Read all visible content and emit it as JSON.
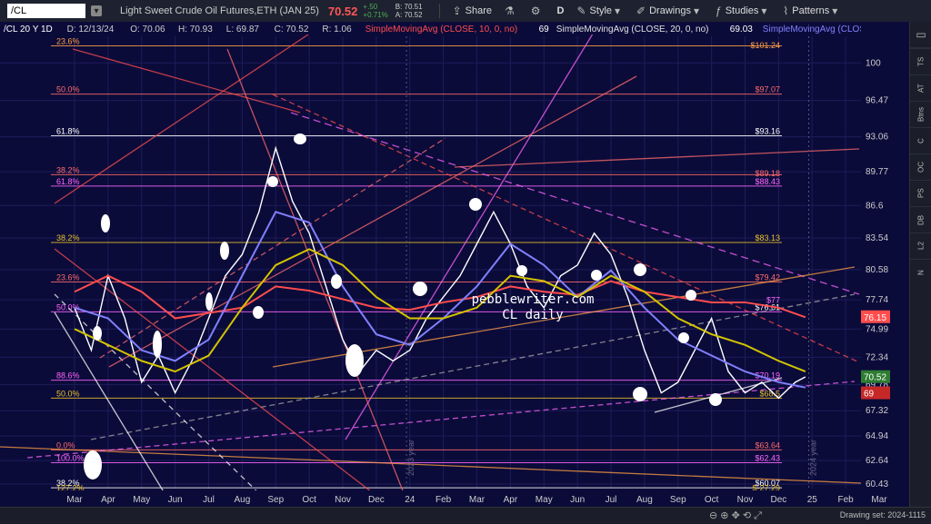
{
  "toolbar": {
    "symbol": "/CL",
    "description": "Light Sweet Crude Oil Futures,ETH (JAN 25)",
    "last": "70.52",
    "change": "+.50",
    "change_pct": "+0.71%",
    "bid": "B: 70.51",
    "ask": "A: 70.52",
    "share": "Share",
    "timeframe": "D",
    "style": "Style",
    "drawings": "Drawings",
    "studies": "Studies",
    "patterns": "Patterns"
  },
  "right_tabs": [
    "TS",
    "AT",
    "Btns",
    "C",
    "OC",
    "PS",
    "DB",
    "L2",
    "N"
  ],
  "bottom": {
    "drawing_set": "Drawing set: 2024-1115"
  },
  "chart_data": {
    "type": "line",
    "header": {
      "symbol": "/CL 20 Y 1D",
      "date": "D: 12/13/24",
      "open": "O: 70.06",
      "high": "H: 70.93",
      "low": "L: 69.87",
      "close": "C: 70.52",
      "range": "R: 1.06",
      "studies": [
        {
          "label": "SimpleMovingAvg (CLOSE, 10, 0, no)",
          "value": "69",
          "color": "#ff4d4d"
        },
        {
          "label": "SimpleMovingAvg (CLOSE, 20, 0, no)",
          "value": "69.03",
          "color": "#e0e0e0"
        },
        {
          "label": "SimpleMovingAvg (CLOSE, 50,...",
          "value": "",
          "color": "#8080ff"
        }
      ]
    },
    "watermark": [
      "pebblewriter.com",
      "CL daily"
    ],
    "ylim": [
      60,
      102.5
    ],
    "y_ticks": [
      100,
      96.47,
      93.06,
      89.77,
      86.6,
      83.54,
      80.58,
      77.74,
      74.99,
      72.34,
      69.78,
      67.32,
      64.94,
      62.64,
      60.43
    ],
    "y_tick_labels": [
      "100",
      "96.47",
      "93.06",
      "89.77",
      "86.6",
      "83.54",
      "80.58",
      "77.74",
      "74.99",
      "72.34",
      "69.78",
      "67.32",
      "64.94",
      "62.64",
      "60.43"
    ],
    "x_ticks": [
      "Mar",
      "Apr",
      "May",
      "Jun",
      "Jul",
      "Aug",
      "Sep",
      "Oct",
      "Nov",
      "Dec",
      "24",
      "Feb",
      "Mar",
      "Apr",
      "May",
      "Jun",
      "Jul",
      "Aug",
      "Sep",
      "Oct",
      "Nov",
      "Dec",
      "25",
      "Feb",
      "Mar"
    ],
    "x_tick_index": [
      0,
      1,
      2,
      3,
      4,
      5,
      6,
      7,
      8,
      9,
      10,
      11,
      12,
      13,
      14,
      15,
      16,
      17,
      18,
      19,
      20,
      21,
      22,
      23,
      24
    ],
    "year_markers": [
      {
        "label": "2023 year",
        "x": 9.9
      },
      {
        "label": "2024 year",
        "x": 21.9
      }
    ],
    "price_badges": [
      {
        "value": "76.15",
        "color": "#ff4d4d"
      },
      {
        "value": "70.52",
        "color": "#2e7d32"
      },
      {
        "value": "69",
        "color": "#c62828"
      }
    ],
    "fib_levels": [
      {
        "label": "23.6%",
        "price": 101.6,
        "color": "#ff9f43"
      },
      {
        "label": "50.0%",
        "price": 97.07,
        "color": "#ff6b6b"
      },
      {
        "label": "61.8%",
        "price": 93.16,
        "color": "#ffffff"
      },
      {
        "label": "38.2%",
        "price": 89.5,
        "color": "#ff6b6b"
      },
      {
        "label": "61.8%",
        "price": 88.43,
        "color": "#ff66ff"
      },
      {
        "label": "38.2%",
        "price": 83.13,
        "color": "#e6c229"
      },
      {
        "label": "23.6%",
        "price": 79.42,
        "color": "#ff6b6b"
      },
      {
        "label": "50.0%",
        "price": 76.61,
        "color": "#ff66ff"
      },
      {
        "label": "88.6%",
        "price": 70.19,
        "color": "#ff66ff"
      },
      {
        "label": "50.0%",
        "price": 68.5,
        "color": "#e6c229"
      },
      {
        "label": "0.0%",
        "price": 63.64,
        "color": "#ff6b6b"
      },
      {
        "label": "100.0%",
        "price": 62.43,
        "color": "#ff66ff"
      },
      {
        "label": "38.2%",
        "price": 60.07,
        "color": "#ffffff"
      },
      {
        "label": "127.2%",
        "price": 59.6,
        "color": "#e6c229"
      }
    ],
    "level_labels": [
      {
        "text": "$101.24",
        "price": 101.24,
        "color": "#ff9f43"
      },
      {
        "text": "$97.07",
        "price": 97.07,
        "color": "#ff6b6b"
      },
      {
        "text": "$93.16",
        "price": 93.16,
        "color": "#ffffff"
      },
      {
        "text": "$89.18",
        "price": 89.18,
        "color": "#ff6b6b"
      },
      {
        "text": "$88.43",
        "price": 88.43,
        "color": "#ff66ff"
      },
      {
        "text": "$83.13",
        "price": 83.13,
        "color": "#e6c229"
      },
      {
        "text": "$79.42",
        "price": 79.42,
        "color": "#ff6b6b"
      },
      {
        "text": "$77",
        "price": 77.3,
        "color": "#ff66ff"
      },
      {
        "text": "$76.61",
        "price": 76.61,
        "color": "#ffffff"
      },
      {
        "text": "$70.19",
        "price": 70.19,
        "color": "#ff66ff"
      },
      {
        "text": "$68.5",
        "price": 68.5,
        "color": "#e6c229"
      },
      {
        "text": "$63.64",
        "price": 63.64,
        "color": "#ff6b6b"
      },
      {
        "text": "$62.43",
        "price": 62.43,
        "color": "#ff66ff"
      },
      {
        "text": "$60.07",
        "price": 60.07,
        "color": "#ffffff"
      },
      {
        "text": "$-27.29",
        "price": 59.6,
        "color": "#e6c229"
      }
    ],
    "series": [
      {
        "color": "#ffffff",
        "x": [
          0,
          0.5,
          1,
          1.5,
          2,
          2.5,
          3,
          3.5,
          4,
          4.5,
          5,
          5.5,
          6,
          6.5,
          7,
          7.5,
          8,
          8.5,
          9,
          9.5,
          10,
          10.5,
          11,
          11.5,
          12,
          12.5,
          13,
          13.5,
          14,
          14.5,
          15,
          15.5,
          16,
          16.5,
          17,
          17.5,
          18,
          18.5,
          19,
          19.5,
          20,
          20.5,
          21,
          21.5,
          21.8
        ],
        "values": [
          77,
          73,
          80,
          76,
          70,
          72.5,
          69,
          72,
          76,
          80,
          82,
          86,
          92,
          87,
          84,
          79,
          74,
          71,
          73,
          72,
          73,
          76,
          78,
          80,
          83,
          86,
          83,
          79,
          77,
          80,
          81,
          84,
          82,
          78,
          73,
          69,
          70,
          73,
          76,
          71,
          69,
          70,
          68.5,
          70,
          70.5
        ]
      },
      {
        "color": "#ff4d4d",
        "x": [
          0,
          1,
          2,
          3,
          4,
          5,
          6,
          7,
          8,
          9,
          10,
          11,
          12,
          13,
          14,
          15,
          16,
          17,
          18,
          19,
          20,
          21,
          21.8
        ],
        "values": [
          78.5,
          80,
          78.5,
          76,
          76.5,
          77,
          79,
          78.6,
          77.8,
          77,
          76.8,
          77.5,
          78,
          79,
          78.5,
          78.2,
          79.5,
          78.5,
          78,
          77.5,
          77.5,
          77,
          76.1
        ]
      },
      {
        "color": "#8080ff",
        "x": [
          0,
          1,
          2,
          3,
          4,
          5,
          6,
          7,
          8,
          9,
          10,
          11,
          12,
          13,
          14,
          15,
          16,
          17,
          18,
          19,
          20,
          21,
          21.8
        ],
        "values": [
          77,
          76,
          73,
          72,
          74,
          80,
          86,
          85,
          79,
          74.5,
          73.5,
          76,
          79,
          83,
          81,
          78,
          80.5,
          77,
          74,
          72.5,
          71,
          70,
          69.5
        ]
      },
      {
        "color": "#d4c400",
        "x": [
          0,
          1,
          2,
          3,
          4,
          5,
          6,
          7,
          8,
          9,
          10,
          11,
          12,
          13,
          14,
          15,
          16,
          17,
          18,
          19,
          20,
          21,
          21.8
        ],
        "values": [
          75,
          73.5,
          72,
          71,
          72.5,
          77,
          81,
          82.5,
          81,
          78,
          76,
          76,
          77,
          80,
          79.5,
          78,
          80,
          78.5,
          76,
          74.5,
          73.5,
          72,
          71
        ]
      }
    ]
  }
}
